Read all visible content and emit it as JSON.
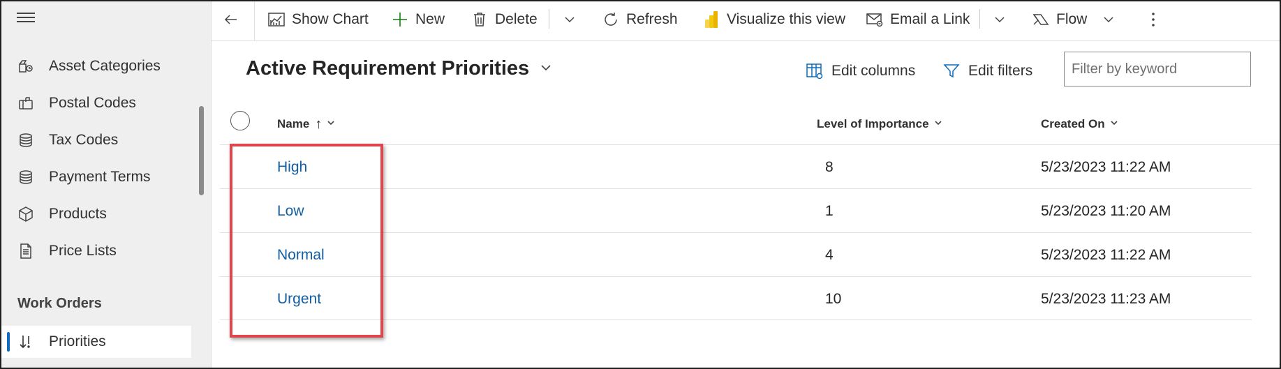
{
  "sidebar": {
    "items": [
      {
        "label": "Asset Categories",
        "icon": "asset-categories-icon"
      },
      {
        "label": "Postal Codes",
        "icon": "mailbox-icon"
      },
      {
        "label": "Tax Codes",
        "icon": "coin-stack-icon"
      },
      {
        "label": "Payment Terms",
        "icon": "coin-stack-icon"
      },
      {
        "label": "Products",
        "icon": "box-icon"
      },
      {
        "label": "Price Lists",
        "icon": "document-list-icon"
      }
    ],
    "section_title": "Work Orders",
    "selected_item": {
      "label": "Priorities",
      "icon": "sort-arrows-icon"
    }
  },
  "toolbar": {
    "show_chart": "Show Chart",
    "new": "New",
    "delete": "Delete",
    "refresh": "Refresh",
    "visualize": "Visualize this view",
    "email_link": "Email a Link",
    "flow": "Flow"
  },
  "view": {
    "title": "Active Requirement Priorities",
    "edit_columns": "Edit columns",
    "edit_filters": "Edit filters",
    "filter_placeholder": "Filter by keyword"
  },
  "grid": {
    "columns": {
      "name": "Name",
      "name_sort": "↑",
      "importance": "Level of Importance",
      "created": "Created On"
    },
    "rows": [
      {
        "name": "High",
        "importance": "8",
        "created": "5/23/2023 11:22 AM"
      },
      {
        "name": "Low",
        "importance": "1",
        "created": "5/23/2023 11:20 AM"
      },
      {
        "name": "Normal",
        "importance": "4",
        "created": "5/23/2023 11:22 AM"
      },
      {
        "name": "Urgent",
        "importance": "10",
        "created": "5/23/2023 11:23 AM"
      }
    ]
  },
  "colors": {
    "accent": "#0f6cbd",
    "link": "#115ea3",
    "highlight_box": "#e0474c",
    "sidebar_bg": "#efefef"
  }
}
